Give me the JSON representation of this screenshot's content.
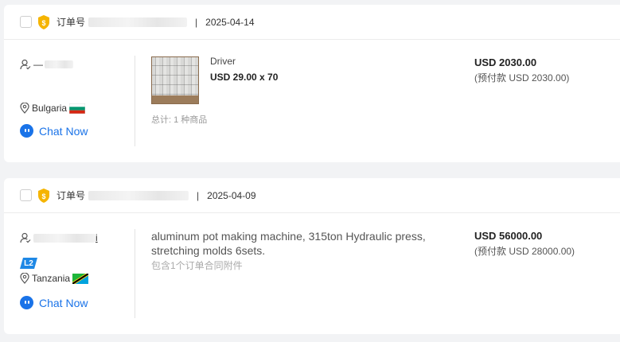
{
  "colors": {
    "accent": "#1a73e8",
    "background": "#f2f3f5",
    "card": "#ffffff",
    "badge_gold": "#f5b400",
    "level_badge": "#1e88e5"
  },
  "orders": [
    {
      "order_label": "订单号",
      "date": "2025-04-14",
      "separator": "|",
      "buyer_name": "—",
      "country": "Bulgaria",
      "chat_label": "Chat Now",
      "product_name": "Driver",
      "price_qty": "USD 29.00 x 70",
      "item_count": "总计: 1 种商品",
      "total": "USD 2030.00",
      "prepay": "(预付款 USD 2030.00)"
    },
    {
      "order_label": "订单号",
      "date": "2025-04-09",
      "separator": "|",
      "buyer_suffix": "i",
      "level": "L2",
      "country": "Tanzania",
      "chat_label": "Chat Now",
      "product_title": "aluminum pot making machine, 315ton Hydraulic press, stretching molds 6sets.",
      "contract_note": "包含1个订单合同附件",
      "total": "USD 56000.00",
      "prepay": "(预付款 USD 28000.00)"
    }
  ]
}
